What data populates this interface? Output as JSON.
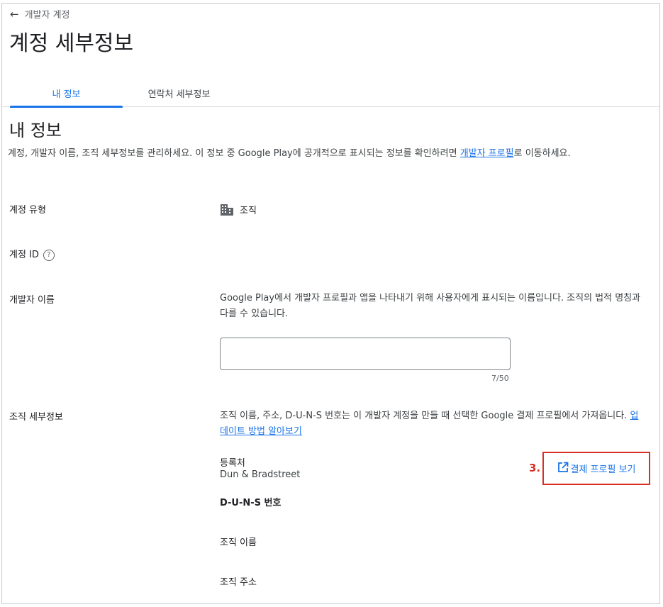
{
  "breadcrumb": {
    "back_label": "개발자 계정"
  },
  "page_title": "계정 세부정보",
  "tabs": [
    {
      "label": "내 정보"
    },
    {
      "label": "연락처 세부정보"
    }
  ],
  "section": {
    "title": "내 정보",
    "desc_before": "계정, 개발자 이름, 조직 세부정보를 관리하세요. 이 정보 중 Google Play에 공개적으로 표시되는 정보를 확인하려면 ",
    "desc_link": "개발자 프로필",
    "desc_after": "로 이동하세요."
  },
  "account_type": {
    "label": "계정 유형",
    "value": "조직",
    "icon": "building-icon"
  },
  "account_id": {
    "label": "계정 ID",
    "help_icon": "?"
  },
  "developer_name": {
    "label": "개발자 이름",
    "desc": "Google Play에서 개발자 프로필과 앱을 나타내기 위해 사용자에게 표시되는 이름입니다. 조직의 법적 명칭과 다를 수 있습니다.",
    "input_value": "",
    "counter": "7/50"
  },
  "org_details": {
    "label": "조직 세부정보",
    "desc": "조직 이름, 주소, D-U-N-S 번호는 이 개발자 계정을 만들 때 선택한 Google 결제 프로필에서 가져옵니다. ",
    "desc_link": "업데이트 방법 알아보기",
    "registry_label": "등록처",
    "registry_value": "Dun & Bradstreet",
    "step_marker": "3.",
    "payment_button": "결제 프로필 보기",
    "duns_label": "D-U-N-S 번호",
    "org_name_label": "조직 이름",
    "org_address_label": "조직 주소"
  },
  "colors": {
    "accent": "#1a73e8",
    "highlight": "#d93025"
  }
}
